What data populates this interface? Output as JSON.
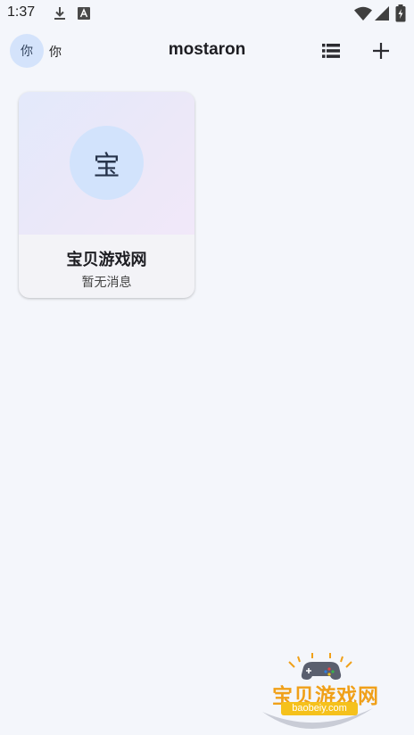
{
  "status_bar": {
    "time": "1:37",
    "icons": [
      "download-icon",
      "font-a-icon",
      "wifi-icon",
      "signal-icon",
      "battery-icon"
    ]
  },
  "header": {
    "avatar_text": "你",
    "user_name": "你",
    "title": "mostaron",
    "buttons": [
      "list-view-icon",
      "add-icon"
    ]
  },
  "chats": [
    {
      "avatar_text": "宝",
      "name": "宝贝游戏网",
      "last_message": "暂无消息"
    }
  ],
  "watermark": {
    "text": "宝贝游戏网",
    "url": "baobeiy.com"
  },
  "colors": {
    "background": "#f4f6fb",
    "avatar_bg": "#d4e3fb",
    "watermark_orange": "#f0a019",
    "watermark_yellow": "#f5c11c"
  }
}
